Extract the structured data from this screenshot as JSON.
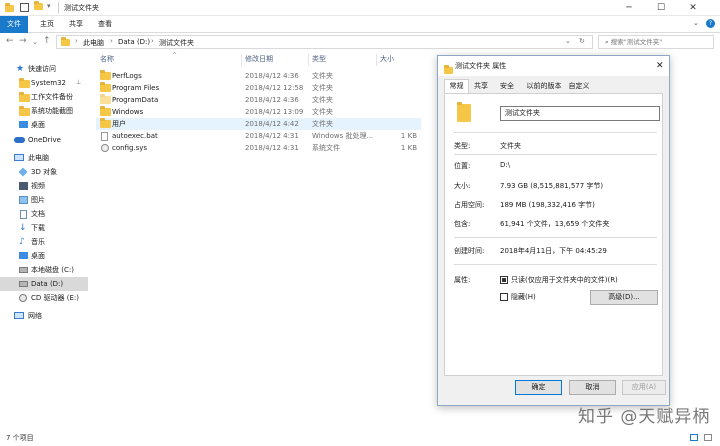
{
  "window": {
    "title": "测试文件夹"
  },
  "ribbon": {
    "tabs": [
      "文件",
      "主页",
      "共享",
      "查看"
    ]
  },
  "address": {
    "crumbs": [
      "此电脑",
      "Data (D:)",
      "测试文件夹"
    ],
    "search_placeholder": "搜索\"测试文件夹\""
  },
  "sidebar": {
    "items": [
      {
        "label": "快速访问",
        "icon": "star-icon"
      },
      {
        "label": "System32",
        "icon": "folder-icon"
      },
      {
        "label": "工作文件备份",
        "icon": "folder-icon"
      },
      {
        "label": "系统功能截图",
        "icon": "folder-icon"
      },
      {
        "label": "桌面",
        "icon": "desktop-icon"
      },
      {
        "label": "OneDrive",
        "icon": "cloud-icon"
      },
      {
        "label": "此电脑",
        "icon": "pc-icon"
      },
      {
        "label": "3D 对象",
        "icon": "cube-icon"
      },
      {
        "label": "视频",
        "icon": "video-icon"
      },
      {
        "label": "图片",
        "icon": "picture-icon"
      },
      {
        "label": "文档",
        "icon": "document-icon"
      },
      {
        "label": "下载",
        "icon": "download-icon"
      },
      {
        "label": "音乐",
        "icon": "music-icon"
      },
      {
        "label": "桌面",
        "icon": "desktop-icon"
      },
      {
        "label": "本地磁盘 (C:)",
        "icon": "drive-icon"
      },
      {
        "label": "Data (D:)",
        "icon": "drive-icon"
      },
      {
        "label": "CD 驱动器 (E:)",
        "icon": "cd-icon"
      },
      {
        "label": "网络",
        "icon": "network-icon"
      }
    ]
  },
  "filelist": {
    "headers": [
      "名称",
      "修改日期",
      "类型",
      "大小"
    ],
    "rows": [
      {
        "name": "PerfLogs",
        "date": "2018/4/12 4:36",
        "type": "文件夹",
        "size": "",
        "icon": "folder-icon"
      },
      {
        "name": "Program Files",
        "date": "2018/4/12 12:58",
        "type": "文件夹",
        "size": "",
        "icon": "folder-icon"
      },
      {
        "name": "ProgramData",
        "date": "2018/4/12 4:36",
        "type": "文件夹",
        "size": "",
        "icon": "folder-icon"
      },
      {
        "name": "Windows",
        "date": "2018/4/12 13:09",
        "type": "文件夹",
        "size": "",
        "icon": "folder-icon"
      },
      {
        "name": "用户",
        "date": "2018/4/12 4:42",
        "type": "文件夹",
        "size": "",
        "icon": "folder-icon"
      },
      {
        "name": "autoexec.bat",
        "date": "2018/4/12 4:31",
        "type": "Windows 批处理...",
        "size": "1 KB",
        "icon": "file-icon"
      },
      {
        "name": "config.sys",
        "date": "2018/4/12 4:31",
        "type": "系统文件",
        "size": "1 KB",
        "icon": "gear-icon"
      }
    ]
  },
  "status": {
    "count": "7 个项目"
  },
  "dialog": {
    "title": "测试文件夹 属性",
    "tabs": [
      "常规",
      "共享",
      "安全",
      "以前的版本",
      "自定义"
    ],
    "name_value": "测试文件夹",
    "props": [
      {
        "label": "类型:",
        "value": "文件夹"
      },
      {
        "label": "位置:",
        "value": "D:\\"
      },
      {
        "label": "大小:",
        "value": "7.93 GB (8,515,881,577 字节)"
      },
      {
        "label": "占用空间:",
        "value": "189 MB (198,332,416 字节)"
      },
      {
        "label": "包含:",
        "value": "61,941 个文件，13,659 个文件夹"
      },
      {
        "label": "创建时间:",
        "value": "2018年4月11日，下午 04:45:29"
      }
    ],
    "attr_label": "属性:",
    "readonly_label": "只读(仅应用于文件夹中的文件)(R)",
    "hidden_label": "隐藏(H)",
    "advanced_label": "高级(D)...",
    "ok_label": "确定",
    "cancel_label": "取消",
    "apply_label": "应用(A)"
  },
  "watermark": "知乎 @天赋异柄"
}
